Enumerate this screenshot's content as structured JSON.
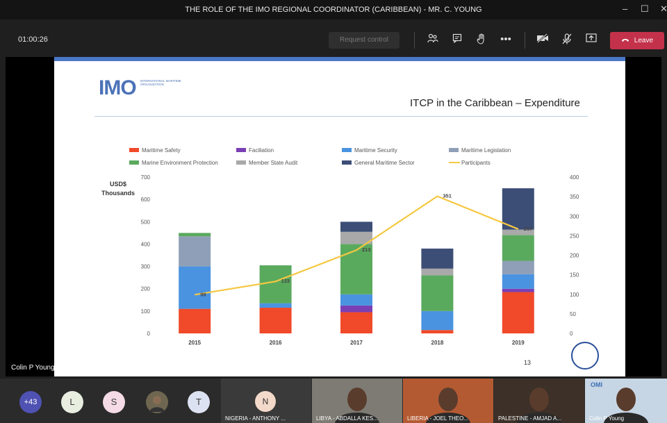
{
  "window": {
    "title": "THE ROLE OF THE IMO REGIONAL COORDINATOR (CARIBBEAN) - MR. C. YOUNG",
    "min_icon": "minimize-icon",
    "max_icon": "maximize-icon",
    "close_icon": "close-icon"
  },
  "toolbar": {
    "timer": "01:00:26",
    "request_control": "Request control",
    "leave": "Leave",
    "icons": [
      "participants-icon",
      "chat-icon",
      "raise-hand-icon",
      "more-icon",
      "camera-off-icon",
      "mic-off-icon",
      "share-icon",
      "phone-icon"
    ]
  },
  "slide": {
    "logo_text": "IMO",
    "logo_subtext": "INTERNATIONAL MARITIME ORGANIZATION",
    "title": "ITCP in the Caribbean – Expenditure",
    "slide_number": "13"
  },
  "chart_data": {
    "type": "bar",
    "stacked": true,
    "categories": [
      "2015",
      "2016",
      "2017",
      "2018",
      "2019"
    ],
    "ylabel": "USD$\nThousands",
    "ylim": [
      0,
      700
    ],
    "yticks": [
      0,
      100,
      200,
      300,
      400,
      500,
      600,
      700
    ],
    "y2lim": [
      0,
      400
    ],
    "y2ticks": [
      0,
      50,
      100,
      150,
      200,
      250,
      300,
      350,
      400
    ],
    "legend_position": "top",
    "series": [
      {
        "name": "Maritime Safety",
        "color": "#f04a2a",
        "values": [
          110,
          115,
          95,
          15,
          185
        ]
      },
      {
        "name": "Faciliation",
        "color": "#7a3fb4",
        "values": [
          0,
          0,
          30,
          0,
          15
        ]
      },
      {
        "name": "Maritime Security",
        "color": "#4a93e0",
        "values": [
          190,
          20,
          50,
          85,
          65
        ]
      },
      {
        "name": "Maritime Legislation",
        "color": "#8f9fb7",
        "values": [
          135,
          0,
          0,
          0,
          60
        ]
      },
      {
        "name": "Marine Environment Protection",
        "color": "#5aaa5e",
        "values": [
          15,
          170,
          225,
          160,
          115
        ]
      },
      {
        "name": "Member State Audit",
        "color": "#a9a9a9",
        "values": [
          0,
          0,
          55,
          30,
          25
        ]
      },
      {
        "name": "General Maritime Sector",
        "color": "#3d4e76",
        "values": [
          0,
          0,
          45,
          90,
          185
        ]
      }
    ],
    "line_series": {
      "name": "Participants",
      "color": "#f5c842",
      "axis": "right",
      "values": [
        99,
        133,
        213,
        351,
        267
      ],
      "labels": [
        "99",
        "133",
        "213",
        "351",
        "267"
      ]
    }
  },
  "participants": {
    "overflow_count": "+43",
    "initials": [
      {
        "letter": "L",
        "bg": "#e8efe0",
        "fg": "#3a3a3a"
      },
      {
        "letter": "S",
        "bg": "#f5dbe6",
        "fg": "#3a3a3a"
      },
      {
        "letter": "T",
        "bg": "#dde2f2",
        "fg": "#3a3a3a"
      }
    ],
    "tiles": [
      {
        "name": "NIGERIA - ANTHONY ...",
        "initial": "N"
      },
      {
        "name": "LIBYA - ABDALLA KES..."
      },
      {
        "name": "LIBERIA - JOEL THEO..."
      },
      {
        "name": "PALESTINE - AMJAD A..."
      },
      {
        "name": "Colin P Young",
        "watermark": "OMI"
      }
    ]
  },
  "speaker": {
    "name": "Colin P Young"
  }
}
